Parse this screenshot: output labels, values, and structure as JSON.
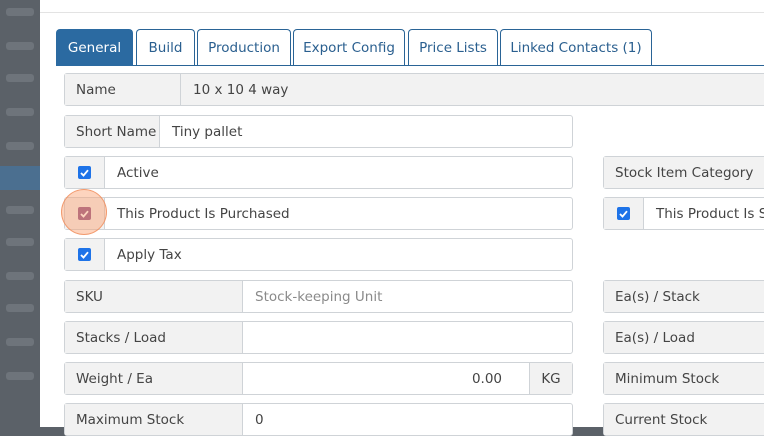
{
  "tabs": [
    {
      "label": "General",
      "active": true
    },
    {
      "label": "Build"
    },
    {
      "label": "Production"
    },
    {
      "label": "Export Config"
    },
    {
      "label": "Price Lists"
    },
    {
      "label": "Linked Contacts (1)"
    }
  ],
  "fields": {
    "name": {
      "label": "Name",
      "value": "10 x 10 4 way"
    },
    "short_name": {
      "label": "Short Name",
      "value": "Tiny pallet"
    },
    "active": {
      "label": "Active",
      "checked": true
    },
    "purchased": {
      "label": "This Product Is Purchased",
      "checked": true
    },
    "apply_tax": {
      "label": "Apply Tax",
      "checked": true
    },
    "sku": {
      "label": "SKU",
      "placeholder": "Stock-keeping Unit"
    },
    "stacks_load": {
      "label": "Stacks / Load",
      "value": ""
    },
    "weight_ea": {
      "label": "Weight / Ea",
      "value": "0.00",
      "unit": "KG"
    },
    "maximum_stock": {
      "label": "Maximum Stock",
      "value": "0"
    }
  },
  "right_fields": {
    "stock_item_category": {
      "label": "Stock Item Category"
    },
    "sold": {
      "label": "This Product Is Sold",
      "checked": true
    },
    "ea_stack": {
      "label": "Ea(s) / Stack"
    },
    "ea_load": {
      "label": "Ea(s) / Load"
    },
    "minimum_stock": {
      "label": "Minimum Stock"
    },
    "current_stock": {
      "label": "Current Stock"
    }
  },
  "colors": {
    "tab_active": "#2b6aa1",
    "checkbox": "#1e73e8",
    "highlight": "#f5a070"
  }
}
